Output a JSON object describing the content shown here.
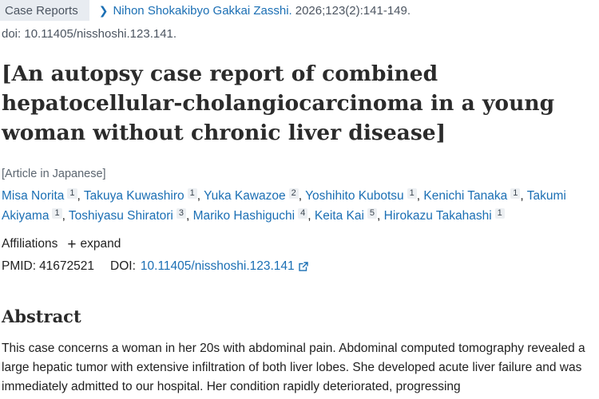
{
  "article_type": "Case Reports",
  "journal": {
    "name": "Nihon Shokakibyo Gakkai Zasshi.",
    "citation": "2026;123(2):141-149."
  },
  "doi_line": "doi: 10.11405/nisshoshi.123.141.",
  "title": "[An autopsy case report of combined hepatocellular-cholangiocarcinoma in a young woman without chronic liver disease]",
  "language_note": "[Article in Japanese]",
  "authors": [
    {
      "name": "Misa Norita",
      "aff": "1"
    },
    {
      "name": "Takuya Kuwashiro",
      "aff": "1"
    },
    {
      "name": "Yuka Kawazoe",
      "aff": "2"
    },
    {
      "name": "Yoshihito Kubotsu",
      "aff": "1"
    },
    {
      "name": "Kenichi Tanaka",
      "aff": "1"
    },
    {
      "name": "Takumi Akiyama",
      "aff": "1"
    },
    {
      "name": "Toshiyasu Shiratori",
      "aff": "3"
    },
    {
      "name": "Mariko Hashiguchi",
      "aff": "4"
    },
    {
      "name": "Keita Kai",
      "aff": "5"
    },
    {
      "name": "Hirokazu Takahashi",
      "aff": "1"
    }
  ],
  "affiliations": {
    "label": "Affiliations",
    "expand_label": "expand",
    "expand_icon": "plus-icon"
  },
  "identifiers": {
    "pmid_label": "PMID:",
    "pmid": "41672521",
    "doi_label": "DOI:",
    "doi": "10.11405/nisshoshi.123.141",
    "doi_icon": "external-link-icon"
  },
  "abstract": {
    "heading": "Abstract",
    "text": "This case concerns a woman in her 20s with abdominal pain. Abdominal computed tomography revealed a large hepatic tumor with extensive infiltration of both liver lobes. She developed acute liver failure and was immediately admitted to our hospital. Her condition rapidly deteriorated, progressing"
  },
  "colors": {
    "link": "#1b6fb4",
    "tag_background": "#e8ecf1",
    "badge_background": "#eceff2"
  }
}
